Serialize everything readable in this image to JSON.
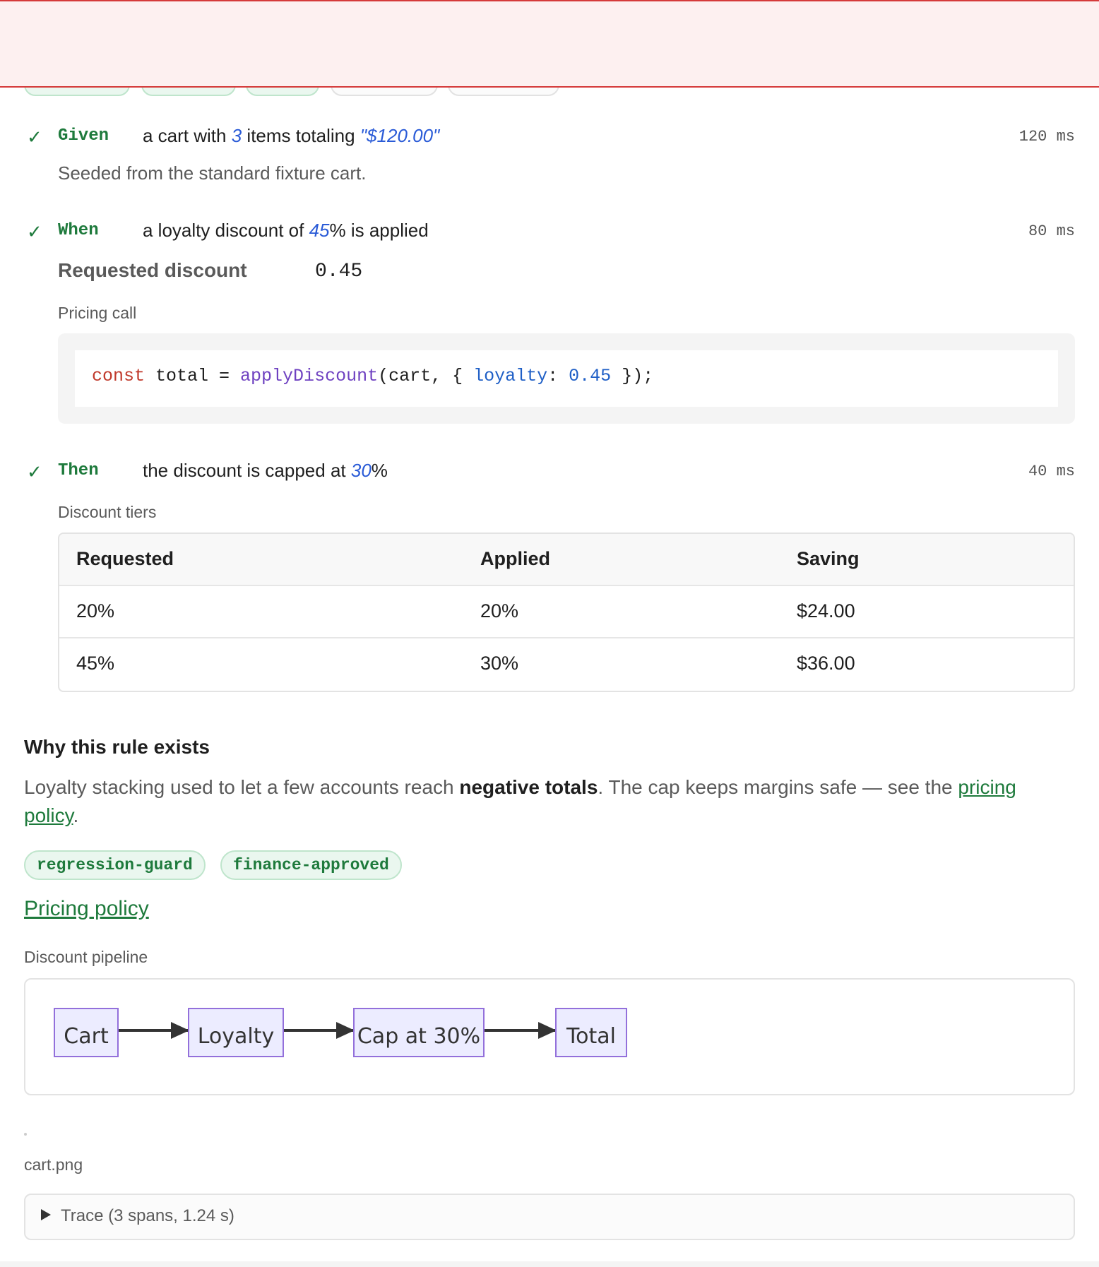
{
  "steps": [
    {
      "keyword": "Given",
      "text_before": "a cart with ",
      "param1": "3",
      "text_mid": " items totaling ",
      "param2": "\"$120.00\"",
      "duration": "120 ms",
      "note": "Seeded from the standard fixture cart."
    },
    {
      "keyword": "When",
      "text_before": "a loyalty discount of ",
      "param1": "45",
      "text_after": "% is applied",
      "duration": "80 ms",
      "kv_key": "Requested discount",
      "kv_value": "0.45",
      "code_label": "Pricing call",
      "code": {
        "kw": "const",
        "var": " total = ",
        "fn": "applyDiscount",
        "args1": "(cart, { ",
        "prop": "loyalty",
        "colon": ": ",
        "num": "0.45",
        "end": " });"
      }
    },
    {
      "keyword": "Then",
      "text_before": "the discount is capped at ",
      "param1": "30",
      "text_after": "%",
      "duration": "40 ms",
      "table_label": "Discount tiers",
      "table": {
        "headers": [
          "Requested",
          "Applied",
          "Saving"
        ],
        "rows": [
          [
            "20%",
            "20%",
            "$24.00"
          ],
          [
            "45%",
            "30%",
            "$36.00"
          ]
        ]
      }
    }
  ],
  "why": {
    "heading": "Why this rule exists",
    "p1": "Loyalty stacking used to let a few accounts reach ",
    "bold": "negative totals",
    "p2": ". The cap keeps margins safe — see the ",
    "link": "pricing policy",
    "p3": "."
  },
  "tags": [
    "regression-guard",
    "finance-approved"
  ],
  "policy_link": "Pricing policy",
  "diagram": {
    "label": "Discount pipeline",
    "nodes": [
      "Cart",
      "Loyalty",
      "Cap at 30%",
      "Total"
    ]
  },
  "attachment": {
    "name": "cart.png"
  },
  "trace": {
    "summary": "Trace (3 spans, 1.24 s)"
  },
  "colors": {
    "accent": "#1e7a3c",
    "param": "#2a5bd7",
    "error_border": "#d53a3a",
    "node_fill": "#ececff",
    "node_border": "#9370db"
  }
}
